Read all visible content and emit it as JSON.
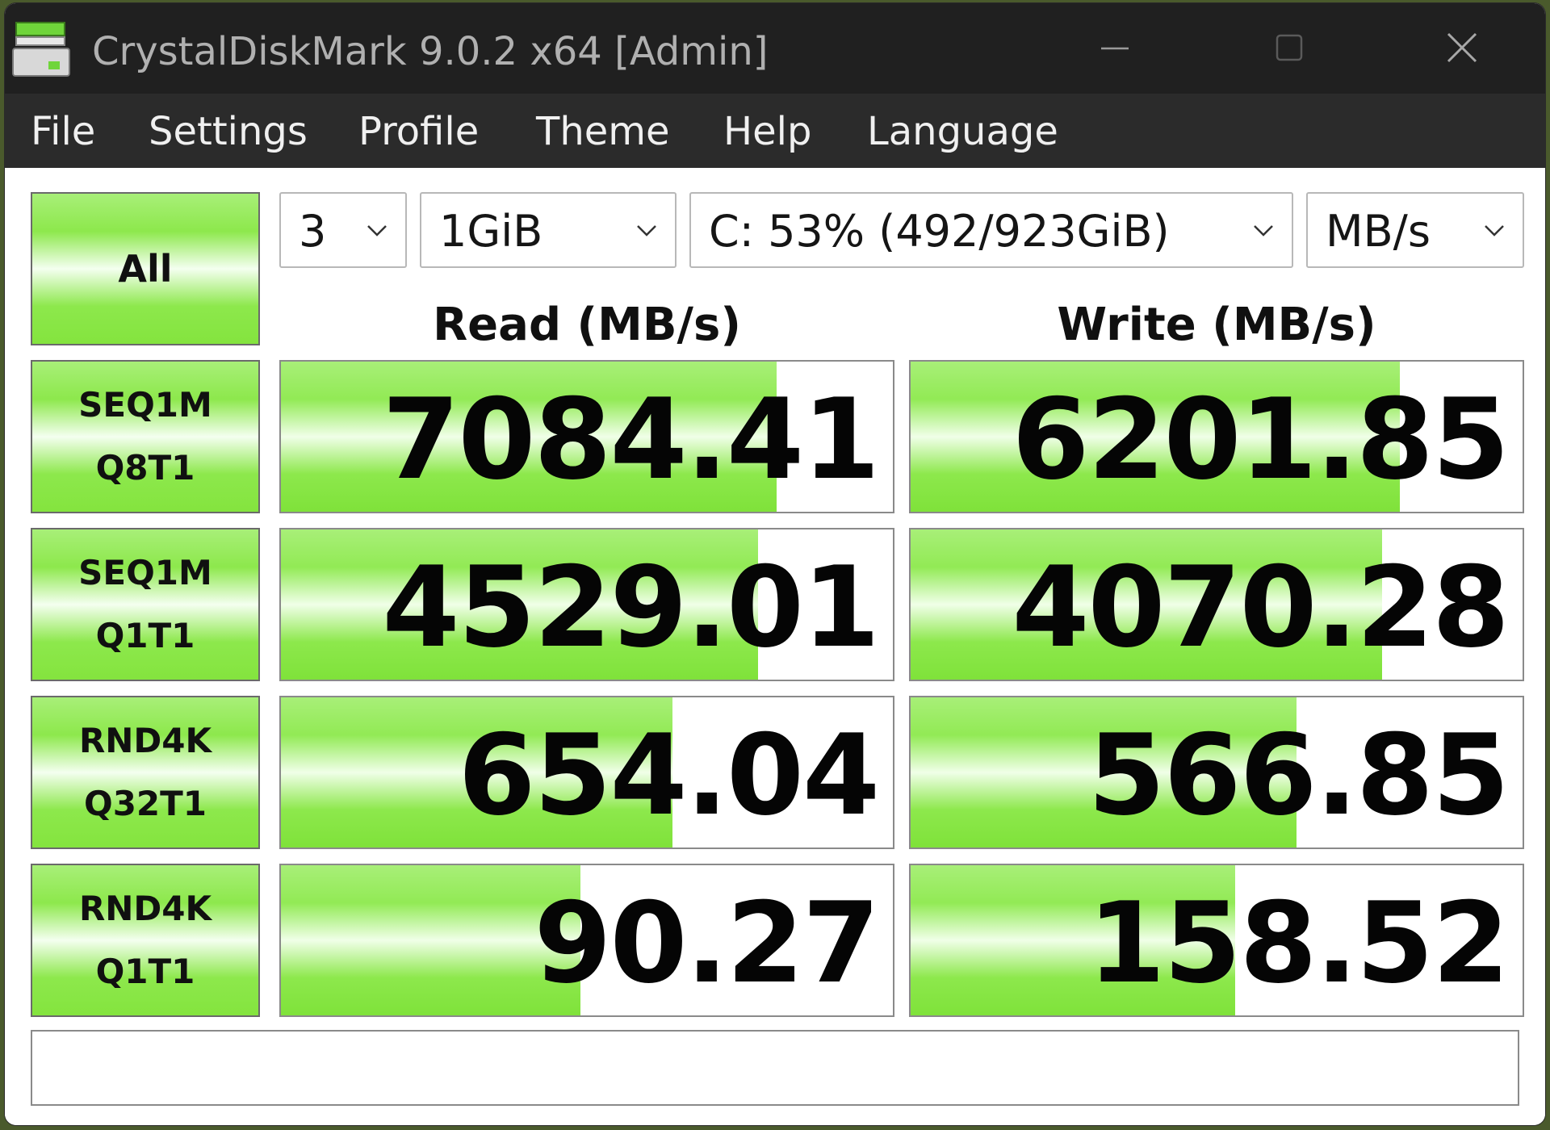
{
  "window": {
    "title": "CrystalDiskMark 9.0.2 x64 [Admin]"
  },
  "menu": [
    "File",
    "Settings",
    "Profile",
    "Theme",
    "Help",
    "Language"
  ],
  "controls": {
    "all_label": "All",
    "count": "3",
    "size": "1GiB",
    "drive": "C: 53% (492/923GiB)",
    "unit": "MB/s"
  },
  "headers": {
    "read": "Read (MB/s)",
    "write": "Write (MB/s)"
  },
  "tests": [
    {
      "line1": "SEQ1M",
      "line2": "Q8T1",
      "read": "7084.41",
      "write": "6201.85",
      "read_fill": 0.81,
      "write_fill": 0.8
    },
    {
      "line1": "SEQ1M",
      "line2": "Q1T1",
      "read": "4529.01",
      "write": "4070.28",
      "read_fill": 0.78,
      "write_fill": 0.77
    },
    {
      "line1": "RND4K",
      "line2": "Q32T1",
      "read": "654.04",
      "write": "566.85",
      "read_fill": 0.64,
      "write_fill": 0.63
    },
    {
      "line1": "RND4K",
      "line2": "Q1T1",
      "read": "90.27",
      "write": "158.52",
      "read_fill": 0.49,
      "write_fill": 0.53
    }
  ],
  "status_text": "",
  "colors": {
    "titlebar": "#202020",
    "menubar": "#2b2b2b",
    "accent_green": "#8de84c"
  }
}
